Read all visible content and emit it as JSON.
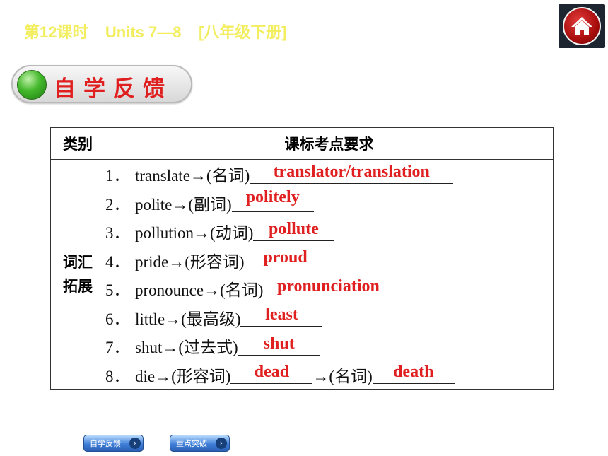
{
  "header": {
    "title": "第12课时    Units 7—8    [八年级下册]"
  },
  "section": {
    "label": "自学反馈"
  },
  "table": {
    "headers": [
      "类别",
      "课标考点要求"
    ],
    "category": [
      "词汇",
      "拓展"
    ],
    "rows": [
      {
        "num": "1．",
        "prefix": "translate→(名词)",
        "answer": "translator/translation",
        "suffix": "",
        "answer2": ""
      },
      {
        "num": "2．",
        "prefix": "polite→(副词)",
        "answer": "politely",
        "suffix": "",
        "answer2": ""
      },
      {
        "num": "3．",
        "prefix": "pollution→(动词)",
        "answer": "pollute",
        "suffix": "",
        "answer2": ""
      },
      {
        "num": "4．",
        "prefix": "pride→(形容词)",
        "answer": "proud",
        "suffix": "",
        "answer2": ""
      },
      {
        "num": "5．",
        "prefix": "pronounce→(名词)",
        "answer": "pronunciation",
        "suffix": "",
        "answer2": ""
      },
      {
        "num": "6．",
        "prefix": "little→(最高级)",
        "answer": "least",
        "suffix": "",
        "answer2": ""
      },
      {
        "num": "7．",
        "prefix": "shut→(过去式)",
        "answer": "shut",
        "suffix": "",
        "answer2": ""
      },
      {
        "num": "8．",
        "prefix": "die→(形容词)",
        "answer": "dead",
        "suffix": "→(名词)",
        "answer2": "death"
      }
    ]
  },
  "nav": {
    "feedback_label": "自学反馈",
    "key_label": "重点突破"
  },
  "colors": {
    "header": "#f2ee60",
    "answer": "#e02020",
    "section_text": "#e02020"
  },
  "icons": {
    "home": "home-icon",
    "status": "green-ball-icon",
    "arrow": "chevron-right-icon"
  }
}
